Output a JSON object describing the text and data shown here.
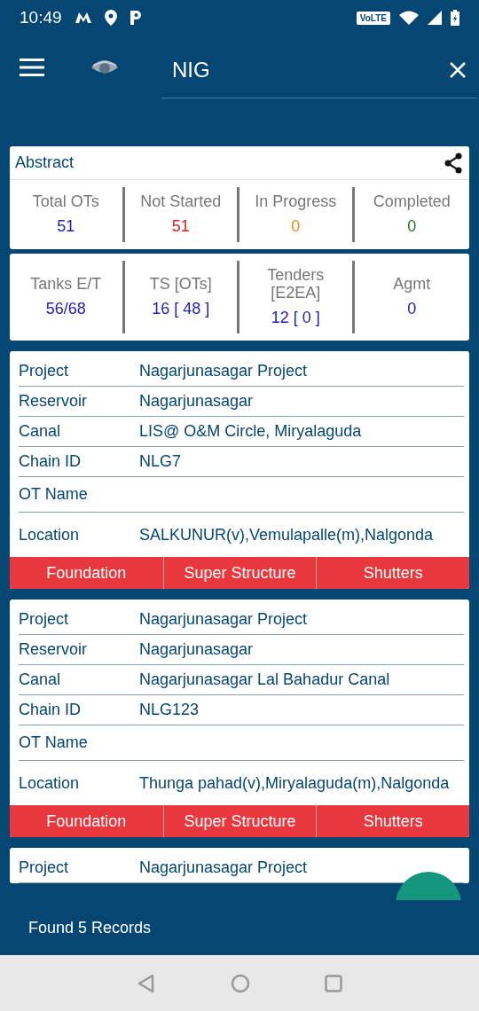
{
  "status_bar": {
    "time": "10:49",
    "network_badge": "VoLTE"
  },
  "search": {
    "value": "NIG"
  },
  "abstract": {
    "title": "Abstract",
    "stats": [
      {
        "label": "Total OTs",
        "value": "51",
        "color": "#2222bb"
      },
      {
        "label": "Not Started",
        "value": "51",
        "color": "#dd2222"
      },
      {
        "label": "In Progress",
        "value": "0",
        "color": "#f08a1c"
      },
      {
        "label": "Completed",
        "value": "0",
        "color": "#1e7a1e"
      }
    ],
    "stats_2": [
      {
        "label": "Tanks E/T",
        "value": "56/68",
        "color": "#2222bb"
      },
      {
        "label": "TS [OTs]",
        "value": "16 [ 48 ]",
        "color": "#2222bb"
      },
      {
        "label": "Tenders [E2EA]",
        "value": "12 [ 0 ]",
        "color": "#2222bb"
      },
      {
        "label": "Agmt",
        "value": "0",
        "color": "#2222bb"
      }
    ]
  },
  "records": [
    {
      "fields": [
        {
          "label": "Project",
          "value": "Nagarjunasagar Project"
        },
        {
          "label": "Reservoir",
          "value": "Nagarjunasagar"
        },
        {
          "label": "Canal",
          "value": "LIS@ O&M Circle, Miryalaguda"
        },
        {
          "label": "Chain ID",
          "value": "NLG7"
        },
        {
          "label": "OT Name"
        },
        {
          "label": "Location",
          "value": "SALKUNUR(v),Vemulapalle(m),Nalgonda"
        }
      ],
      "buttons": [
        "Foundation",
        "Super Structure",
        "Shutters"
      ]
    },
    {
      "fields": [
        {
          "label": "Project",
          "value": "Nagarjunasagar Project"
        },
        {
          "label": "Reservoir",
          "value": "Nagarjunasagar"
        },
        {
          "label": "Canal",
          "value": "Nagarjunasagar Lal Bahadur Canal"
        },
        {
          "label": "Chain ID",
          "value": "NLG123"
        },
        {
          "label": "OT Name"
        },
        {
          "label": "Location",
          "value": "Thunga pahad(v),Miryalaguda(m),Nalgonda"
        }
      ],
      "buttons": [
        "Foundation",
        "Super Structure",
        "Shutters"
      ]
    },
    {
      "fields": [
        {
          "label": "Project",
          "value": "Nagarjunasagar Project"
        }
      ]
    }
  ],
  "footer": {
    "text": "Found 5 Records"
  }
}
